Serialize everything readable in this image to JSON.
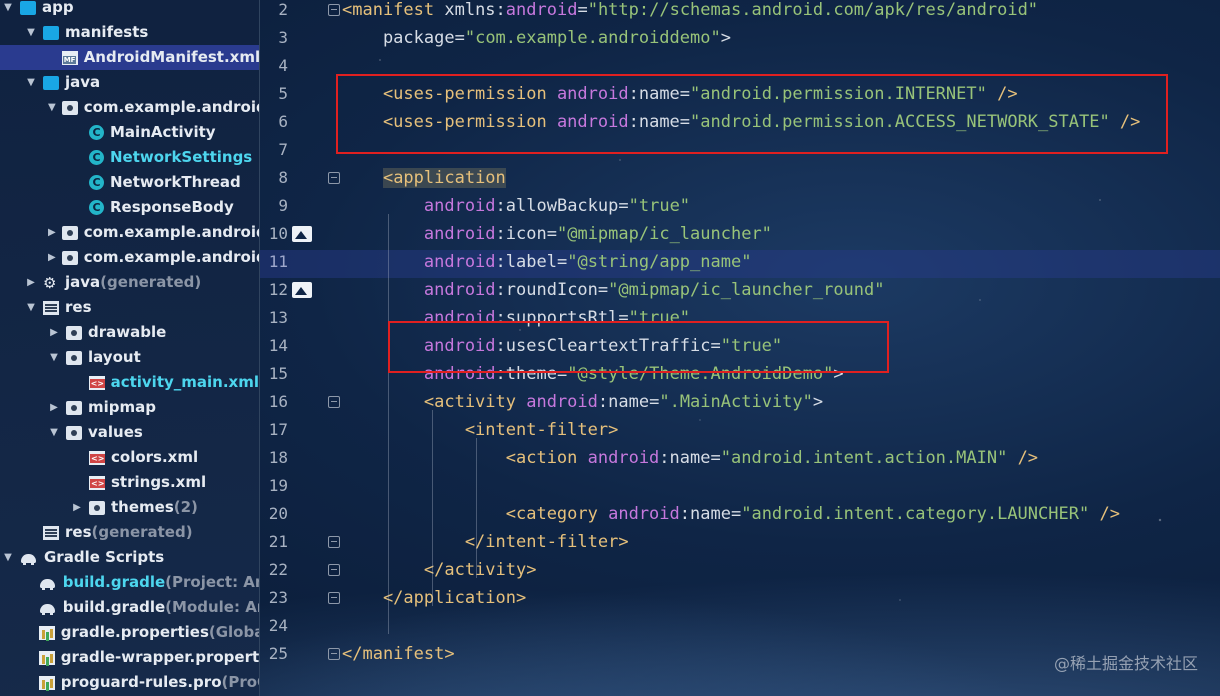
{
  "project_tree": [
    {
      "label": "app",
      "indent": 0,
      "expanded": true,
      "icon": "folder-icon"
    },
    {
      "label": "manifests",
      "indent": 1,
      "expanded": true,
      "icon": "folder-icon"
    },
    {
      "label": "AndroidManifest.xml",
      "indent": 2,
      "icon": "manifest-file-icon",
      "selected": true
    },
    {
      "label": "java",
      "indent": 1,
      "expanded": true,
      "icon": "folder-icon"
    },
    {
      "label": "com.example.androiddemo",
      "indent": 2,
      "expanded": true,
      "icon": "package-icon"
    },
    {
      "label": "MainActivity",
      "indent": 3,
      "icon": "class-icon"
    },
    {
      "label": "NetworkSettings",
      "indent": 3,
      "icon": "class-icon",
      "highlight": true
    },
    {
      "label": "NetworkThread",
      "indent": 3,
      "icon": "class-icon"
    },
    {
      "label": "ResponseBody",
      "indent": 3,
      "icon": "class-icon"
    },
    {
      "label": "com.example.androiddemo",
      "indent": 2,
      "expanded": false,
      "icon": "package-icon"
    },
    {
      "label": "com.example.androiddemo",
      "indent": 2,
      "expanded": false,
      "icon": "package-icon"
    },
    {
      "label": "java",
      "suffix": "(generated)",
      "indent": 1,
      "expanded": false,
      "icon": "generated-folder-icon"
    },
    {
      "label": "res",
      "indent": 1,
      "expanded": true,
      "icon": "res-folder-icon"
    },
    {
      "label": "drawable",
      "indent": 2,
      "expanded": false,
      "icon": "folder-icon"
    },
    {
      "label": "layout",
      "indent": 2,
      "expanded": true,
      "icon": "folder-icon"
    },
    {
      "label": "activity_main.xml",
      "indent": 3,
      "icon": "xml-file-icon",
      "highlight": true
    },
    {
      "label": "mipmap",
      "indent": 2,
      "expanded": false,
      "icon": "folder-icon"
    },
    {
      "label": "values",
      "indent": 2,
      "expanded": true,
      "icon": "folder-icon"
    },
    {
      "label": "colors.xml",
      "indent": 3,
      "icon": "xml-file-icon"
    },
    {
      "label": "strings.xml",
      "indent": 3,
      "icon": "xml-file-icon"
    },
    {
      "label": "themes",
      "suffix": "(2)",
      "indent": 3,
      "expanded": false,
      "icon": "folder-icon"
    },
    {
      "label": "res",
      "suffix": "(generated)",
      "indent": 1,
      "icon": "res-folder-icon"
    },
    {
      "label": "Gradle Scripts",
      "indent": 0,
      "expanded": true,
      "icon": "gradle-icon"
    },
    {
      "label": "build.gradle",
      "suffix": "(Project: AndroidDemo)",
      "indent": 1,
      "icon": "gradle-icon",
      "highlight": true
    },
    {
      "label": "build.gradle",
      "suffix": "(Module: AndroidDemo.app)",
      "indent": 1,
      "icon": "gradle-icon"
    },
    {
      "label": "gradle.properties",
      "suffix": "(Global Properties)",
      "indent": 1,
      "icon": "properties-icon"
    },
    {
      "label": "gradle-wrapper.properties",
      "indent": 1,
      "icon": "properties-icon"
    },
    {
      "label": "proguard-rules.pro",
      "suffix": "(ProGuard Rules)",
      "indent": 1,
      "icon": "properties-icon"
    }
  ],
  "editor": {
    "current_line": 11,
    "lines": [
      {
        "n": "2",
        "tokens": [
          [
            "tag",
            "<manifest "
          ],
          [
            "attr",
            "xmlns"
          ],
          [
            "punct",
            ":"
          ],
          [
            "ns",
            "android"
          ],
          [
            "punct",
            "="
          ],
          [
            "str",
            "\"http://schemas.android.com/apk/res/android\""
          ]
        ]
      },
      {
        "n": "3",
        "tokens": [
          [
            "attr",
            "    package"
          ],
          [
            "punct",
            "="
          ],
          [
            "str",
            "\"com.example.androiddemo\""
          ],
          [
            "punct",
            ">"
          ]
        ]
      },
      {
        "n": "4",
        "tokens": []
      },
      {
        "n": "5",
        "tokens": [
          [
            "tag",
            "    <uses-permission "
          ],
          [
            "ns",
            "android"
          ],
          [
            "punct",
            ":"
          ],
          [
            "attr",
            "name"
          ],
          [
            "punct",
            "="
          ],
          [
            "str",
            "\"android.permission.INTERNET\""
          ],
          [
            "tag",
            " />"
          ]
        ]
      },
      {
        "n": "6",
        "tokens": [
          [
            "tag",
            "    <uses-permission "
          ],
          [
            "ns",
            "android"
          ],
          [
            "punct",
            ":"
          ],
          [
            "attr",
            "name"
          ],
          [
            "punct",
            "="
          ],
          [
            "str",
            "\"android.permission.ACCESS_NETWORK_STATE\""
          ],
          [
            "tag",
            " />"
          ]
        ]
      },
      {
        "n": "7",
        "tokens": []
      },
      {
        "n": "8",
        "tokens": [
          [
            "punct",
            "    "
          ],
          [
            "tag hl-app",
            "<application"
          ]
        ]
      },
      {
        "n": "9",
        "tokens": [
          [
            "ns",
            "        android"
          ],
          [
            "punct",
            ":"
          ],
          [
            "attr",
            "allowBackup"
          ],
          [
            "punct",
            "="
          ],
          [
            "str",
            "\"true\""
          ]
        ]
      },
      {
        "n": "10",
        "tokens": [
          [
            "ns",
            "        android"
          ],
          [
            "punct",
            ":"
          ],
          [
            "attr",
            "icon"
          ],
          [
            "punct",
            "="
          ],
          [
            "str",
            "\"@mipmap/ic_launcher\""
          ]
        ]
      },
      {
        "n": "11",
        "tokens": [
          [
            "ns",
            "        android"
          ],
          [
            "punct",
            ":"
          ],
          [
            "attr",
            "label"
          ],
          [
            "punct",
            "="
          ],
          [
            "str",
            "\"@string/app_name\""
          ]
        ]
      },
      {
        "n": "12",
        "tokens": [
          [
            "ns",
            "        android"
          ],
          [
            "punct",
            ":"
          ],
          [
            "attr",
            "roundIcon"
          ],
          [
            "punct",
            "="
          ],
          [
            "str",
            "\"@mipmap/ic_launcher_round\""
          ]
        ]
      },
      {
        "n": "13",
        "tokens": [
          [
            "ns",
            "        android"
          ],
          [
            "punct",
            ":"
          ],
          [
            "attr",
            "supportsRtl"
          ],
          [
            "punct",
            "="
          ],
          [
            "str",
            "\"true\""
          ]
        ]
      },
      {
        "n": "14",
        "tokens": [
          [
            "ns",
            "        android"
          ],
          [
            "punct",
            ":"
          ],
          [
            "attr",
            "usesCleartextTraffic"
          ],
          [
            "punct",
            "="
          ],
          [
            "str",
            "\"true\""
          ]
        ]
      },
      {
        "n": "15",
        "tokens": [
          [
            "ns",
            "        android"
          ],
          [
            "punct",
            ":"
          ],
          [
            "attr",
            "theme"
          ],
          [
            "punct",
            "="
          ],
          [
            "str",
            "\"@style/Theme.AndroidDemo\""
          ],
          [
            "punct",
            ">"
          ]
        ]
      },
      {
        "n": "16",
        "tokens": [
          [
            "tag",
            "        <activity "
          ],
          [
            "ns",
            "android"
          ],
          [
            "punct",
            ":"
          ],
          [
            "attr",
            "name"
          ],
          [
            "punct",
            "="
          ],
          [
            "str",
            "\".MainActivity\""
          ],
          [
            "punct",
            ">"
          ]
        ]
      },
      {
        "n": "17",
        "tokens": [
          [
            "tag",
            "            <intent-filter>"
          ]
        ]
      },
      {
        "n": "18",
        "tokens": [
          [
            "tag",
            "                <action "
          ],
          [
            "ns",
            "android"
          ],
          [
            "punct",
            ":"
          ],
          [
            "attr",
            "name"
          ],
          [
            "punct",
            "="
          ],
          [
            "str",
            "\"android.intent.action.MAIN\""
          ],
          [
            "tag",
            " />"
          ]
        ]
      },
      {
        "n": "19",
        "tokens": []
      },
      {
        "n": "20",
        "tokens": [
          [
            "tag",
            "                <category "
          ],
          [
            "ns",
            "android"
          ],
          [
            "punct",
            ":"
          ],
          [
            "attr",
            "name"
          ],
          [
            "punct",
            "="
          ],
          [
            "str",
            "\"android.intent.category.LAUNCHER\""
          ],
          [
            "tag",
            " />"
          ]
        ]
      },
      {
        "n": "21",
        "tokens": [
          [
            "tag",
            "            </intent-filter>"
          ]
        ]
      },
      {
        "n": "22",
        "tokens": [
          [
            "tag",
            "        </activity>"
          ]
        ]
      },
      {
        "n": "23",
        "tokens": [
          [
            "tag",
            "    </application>"
          ]
        ]
      },
      {
        "n": "24",
        "tokens": []
      },
      {
        "n": "25",
        "tokens": [
          [
            "tag",
            "</manifest>"
          ]
        ]
      }
    ]
  },
  "watermark": "@稀土掘金技术社区",
  "colors": {
    "tag": "#e6c07b",
    "namespace": "#c678dd",
    "string": "#98c379",
    "selection": "#2a3b8f",
    "annotation_box": "#e02020"
  }
}
